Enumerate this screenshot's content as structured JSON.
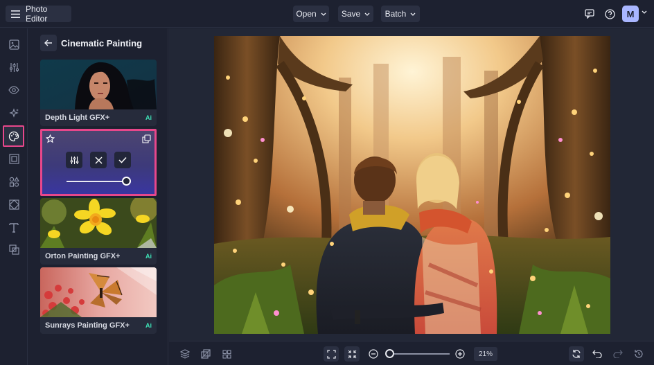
{
  "app": {
    "title": "Photo Editor"
  },
  "toolbar": {
    "open_label": "Open",
    "save_label": "Save",
    "batch_label": "Batch",
    "avatar_initial": "M"
  },
  "rail": {
    "items": [
      {
        "name": "image-icon"
      },
      {
        "name": "adjust-icon"
      },
      {
        "name": "eye-icon"
      },
      {
        "name": "sparkle-icon"
      },
      {
        "name": "palette-icon",
        "active": true
      },
      {
        "name": "frame-icon"
      },
      {
        "name": "graphics-icon"
      },
      {
        "name": "texture-icon"
      },
      {
        "name": "text-icon"
      },
      {
        "name": "overlay-icon"
      }
    ]
  },
  "panel": {
    "title": "Cinematic Painting",
    "cards": [
      {
        "label": "Depth Light GFX+",
        "badge": "Ai"
      },
      {
        "label": "Orton Painting GFX+",
        "badge": "Ai"
      },
      {
        "label": "Sunrays Painting GFX+",
        "badge": "Ai"
      }
    ],
    "active_card": {
      "intensity": 0.9
    }
  },
  "bottom": {
    "zoom_label": "21%",
    "zoom_slider": 0.05
  },
  "colors": {
    "accent": "#e8478b",
    "background": "#1d2130",
    "surface": "#2b3042",
    "ai_badge": "#3ee0b5"
  }
}
